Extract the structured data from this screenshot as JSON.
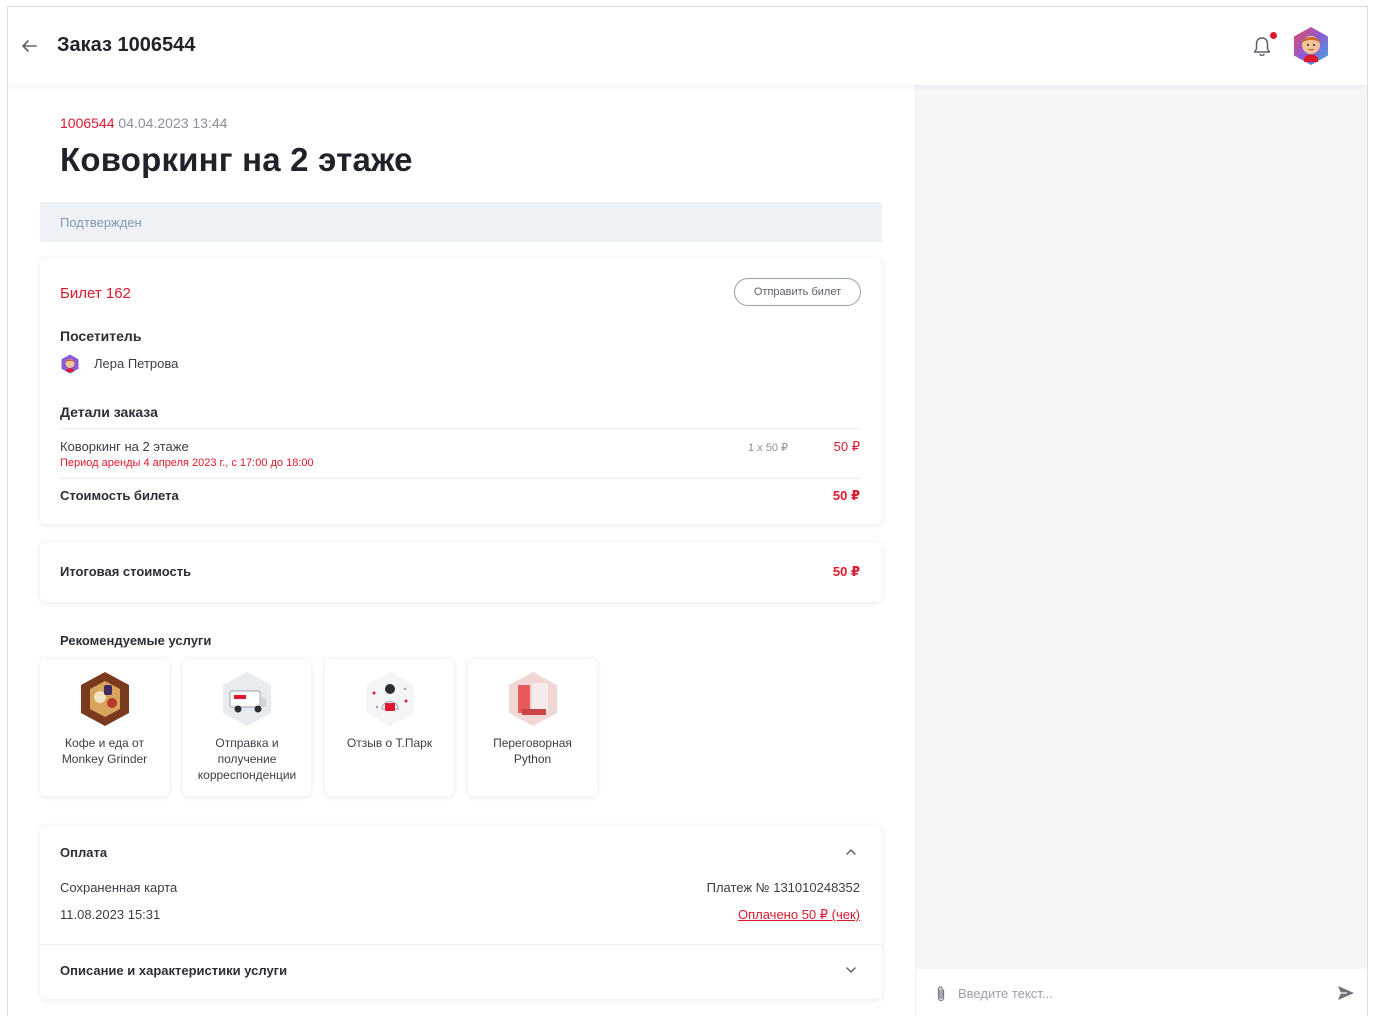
{
  "header": {
    "title": "Заказ 1006544",
    "back_icon": "arrow-left-icon",
    "bell_icon": "bell-icon",
    "notification_color": "#e0182d"
  },
  "order": {
    "number": "1006544",
    "datetime": "04.04.2023 13:44",
    "title": "Коворкинг на 2 этаже",
    "status": "Подтвержден"
  },
  "ticket": {
    "label": "Билет 162",
    "send_button": "Отправить билет",
    "visitor_heading": "Посетитель",
    "visitor_name": "Лера Петрова",
    "details_heading": "Детали заказа",
    "line_name": "Коворкинг на 2 этаже",
    "line_period": "Период аренды 4 апреля 2023 г., с 17:00 до 18:00",
    "line_qty": "1 x 50 ₽",
    "line_price": "50 ₽",
    "cost_label": "Стоимость билета",
    "cost_value": "50 ₽"
  },
  "total": {
    "label": "Итоговая стоимость",
    "value": "50 ₽"
  },
  "recommended": {
    "title": "Рекомендуемые услуги",
    "items": [
      {
        "label": "Кофе и еда от Monkey Grinder"
      },
      {
        "label": "Отправка и получение корреспонденции"
      },
      {
        "label": "Отзыв о Т.Парк"
      },
      {
        "label": "Переговорная Python"
      }
    ]
  },
  "payment": {
    "heading": "Оплата",
    "method": "Сохраненная карта",
    "date": "11.08.2023 15:31",
    "payment_no": "Платеж № 131010248352",
    "paid_link": "Оплачено 50 ₽ (чек)"
  },
  "description": {
    "heading": "Описание и характеристики услуги"
  },
  "chat": {
    "placeholder": "Введите текст..."
  },
  "colors": {
    "accent": "#e0182d",
    "status_bg": "#eef1f6",
    "chat_bg": "#f5f6f8"
  }
}
